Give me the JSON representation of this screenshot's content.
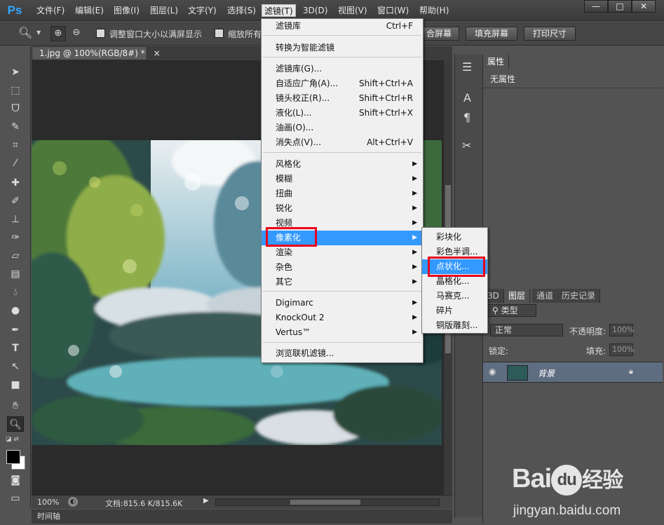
{
  "app": {
    "logo": "Ps"
  },
  "menubar": {
    "items": [
      "文件(F)",
      "编辑(E)",
      "图像(I)",
      "图层(L)",
      "文字(Y)",
      "选择(S)",
      "滤镜(T)",
      "3D(D)",
      "视图(V)",
      "窗口(W)",
      "帮助(H)"
    ]
  },
  "window_controls": {
    "minimize": "—",
    "maximize": "□",
    "close": "✕"
  },
  "options_bar": {
    "resize_windows_label": "调整窗口大小以满屏显示",
    "zoom_all_label": "缩放所有",
    "fit_screen_label": "合屏幕",
    "fill_screen_label": "填充屏幕",
    "print_size_label": "打印尺寸"
  },
  "document": {
    "tab_title": "1.jpg @ 100%(RGB/8#) *",
    "tab_close": "×"
  },
  "filter_menu": {
    "items": [
      {
        "label": "滤镜库",
        "shortcut": "Ctrl+F"
      },
      {
        "label": "转换为智能滤镜",
        "shortcut": ""
      },
      {
        "label": "滤镜库(G)...",
        "shortcut": ""
      },
      {
        "label": "自适应广角(A)...",
        "shortcut": "Shift+Ctrl+A"
      },
      {
        "label": "镜头校正(R)...",
        "shortcut": "Shift+Ctrl+R"
      },
      {
        "label": "液化(L)...",
        "shortcut": "Shift+Ctrl+X"
      },
      {
        "label": "油画(O)...",
        "shortcut": ""
      },
      {
        "label": "消失点(V)...",
        "shortcut": "Alt+Ctrl+V"
      },
      {
        "label": "风格化",
        "shortcut": ""
      },
      {
        "label": "模糊",
        "shortcut": ""
      },
      {
        "label": "扭曲",
        "shortcut": ""
      },
      {
        "label": "锐化",
        "shortcut": ""
      },
      {
        "label": "视频",
        "shortcut": ""
      },
      {
        "label": "像素化",
        "shortcut": ""
      },
      {
        "label": "渲染",
        "shortcut": ""
      },
      {
        "label": "杂色",
        "shortcut": ""
      },
      {
        "label": "其它",
        "shortcut": ""
      },
      {
        "label": "Digimarc",
        "shortcut": ""
      },
      {
        "label": "KnockOut 2",
        "shortcut": ""
      },
      {
        "label": "Vertus™",
        "shortcut": ""
      },
      {
        "label": "浏览联机滤镜...",
        "shortcut": ""
      }
    ]
  },
  "pixelate_submenu": {
    "items": [
      "彩块化",
      "彩色半调...",
      "点状化...",
      "晶格化...",
      "马赛克...",
      "碎片",
      "铜版雕刻..."
    ]
  },
  "properties_panel": {
    "tab": "属性",
    "empty_text": "无属性"
  },
  "layers_panel": {
    "tabs": [
      "3D",
      "图层",
      "通道",
      "历史记录"
    ],
    "filter_label": "类型",
    "blend_mode": "正常",
    "opacity_label": "不透明度:",
    "opacity_value": "100%",
    "lock_label": "锁定:",
    "fill_label": "填充:",
    "fill_value": "100%",
    "layer_name": "背景"
  },
  "status_bar": {
    "zoom": "100%",
    "doc_info": "文档:815.6 K/815.6K"
  },
  "timeline": {
    "label": "时间轴"
  },
  "watermark": {
    "brand": "Bai",
    "brand2": "du",
    "cn": "经验",
    "url": "jingyan.baidu.com"
  },
  "colors": {
    "accent": "#3399ff",
    "highlight_box": "#e8001c",
    "ps_blue": "#31a8ff"
  }
}
